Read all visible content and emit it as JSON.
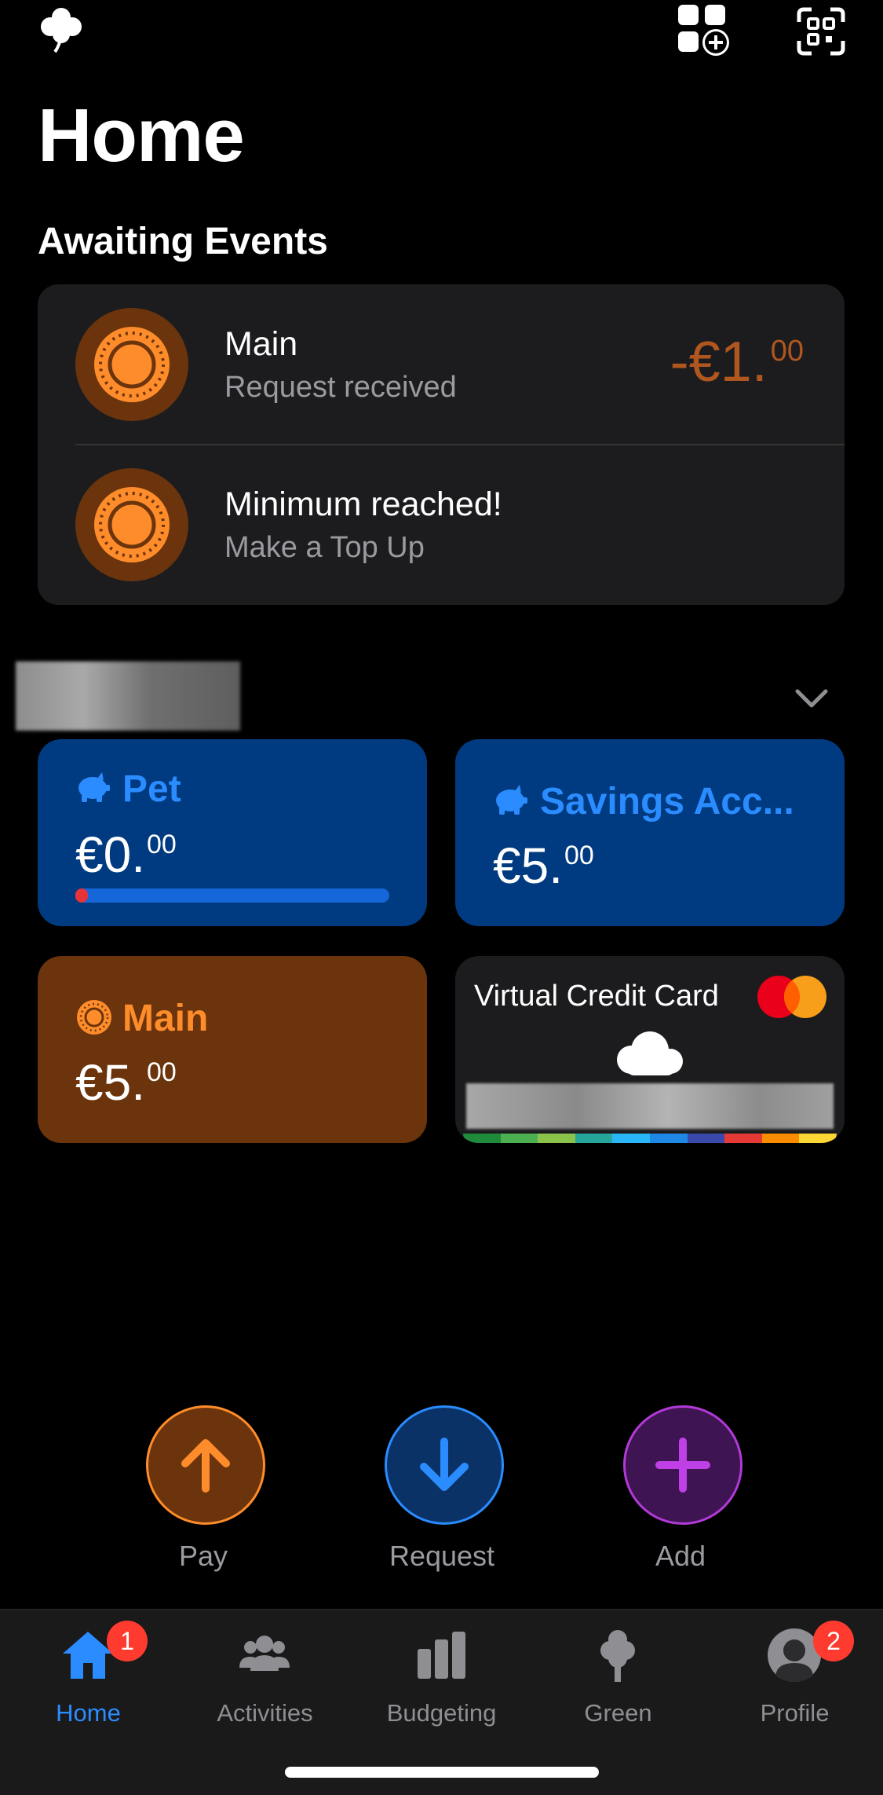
{
  "header": {
    "title": "Home",
    "left_icon": "clover-icon",
    "right_icons": [
      "widget-add-icon",
      "qr-scan-icon"
    ]
  },
  "awaiting": {
    "title": "Awaiting Events",
    "items": [
      {
        "title": "Main",
        "subtitle": "Request received",
        "amount_main": "-€1.",
        "amount_cents": "00",
        "icon": "main-sun-icon"
      },
      {
        "title": "Minimum reached!",
        "subtitle": "Make a Top Up",
        "icon": "main-sun-icon"
      }
    ]
  },
  "accounts": {
    "tiles": [
      {
        "label": "Pet",
        "balance_main": "€0.",
        "balance_cents": "00",
        "icon": "piggy-bank-icon",
        "progress": 0.03
      },
      {
        "label": "Savings Acc...",
        "balance_main": "€5.",
        "balance_cents": "00",
        "icon": "piggy-bank-icon"
      },
      {
        "label": "Main",
        "balance_main": "€5.",
        "balance_cents": "00",
        "icon": "main-sun-icon"
      }
    ],
    "card": {
      "title": "Virtual Credit Card",
      "brand_icon": "mastercard-icon",
      "icon": "cloud-icon"
    },
    "collapse_icon": "chevron-down-icon"
  },
  "actions": [
    {
      "label": "Pay",
      "icon": "arrow-up-icon"
    },
    {
      "label": "Request",
      "icon": "arrow-down-icon"
    },
    {
      "label": "Add",
      "icon": "plus-icon"
    }
  ],
  "tabs": [
    {
      "label": "Home",
      "badge": "1",
      "icon": "home-icon",
      "active": true
    },
    {
      "label": "Activities",
      "icon": "people-icon"
    },
    {
      "label": "Budgeting",
      "icon": "bars-icon"
    },
    {
      "label": "Green",
      "icon": "tree-icon"
    },
    {
      "label": "Profile",
      "badge": "2",
      "icon": "profile-icon"
    }
  ],
  "colors": {
    "accent_blue": "#2a8cff",
    "accent_orange": "#ff8c2a",
    "accent_purple": "#b23ad8",
    "savings_tile": "#003a80",
    "main_tile": "#6b340c",
    "badge_red": "#ff3b30"
  }
}
